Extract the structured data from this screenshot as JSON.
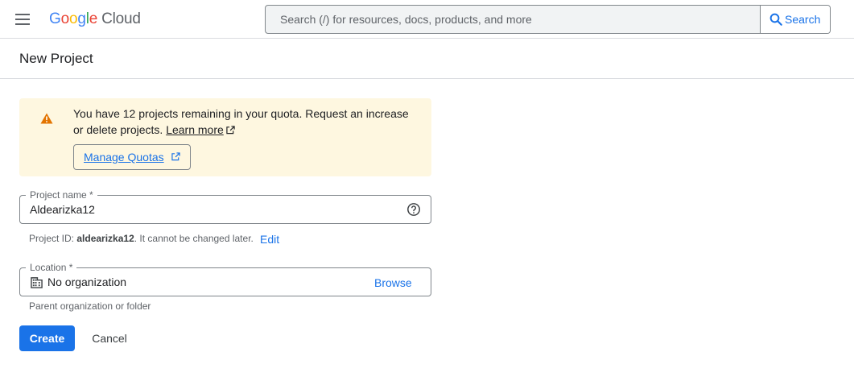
{
  "header": {
    "logo": {
      "g1": "G",
      "o1": "o",
      "o2": "o",
      "g2": "g",
      "l": "l",
      "e": "e",
      "cloud": "Cloud"
    },
    "search": {
      "placeholder": "Search (/) for resources, docs, products, and more",
      "button_label": "Search"
    }
  },
  "page": {
    "title": "New Project"
  },
  "notice": {
    "text": "You have 12 projects remaining in your quota. Request an increase or delete projects.",
    "learn_more": "Learn more",
    "manage_quotas": "Manage Quotas"
  },
  "project_name": {
    "label": "Project name *",
    "value": "Aldearizka12",
    "id_prefix": "Project ID:",
    "id_value": "aldearizka12",
    "id_suffix": ". It cannot be changed later.",
    "edit_label": "Edit"
  },
  "location": {
    "label": "Location *",
    "value": "No organization",
    "browse_label": "Browse",
    "hint": "Parent organization or folder"
  },
  "actions": {
    "create_label": "Create",
    "cancel_label": "Cancel"
  },
  "colors": {
    "primary": "#1a73e8",
    "warning_bg": "#fef7e0",
    "warning_icon": "#e37400"
  }
}
